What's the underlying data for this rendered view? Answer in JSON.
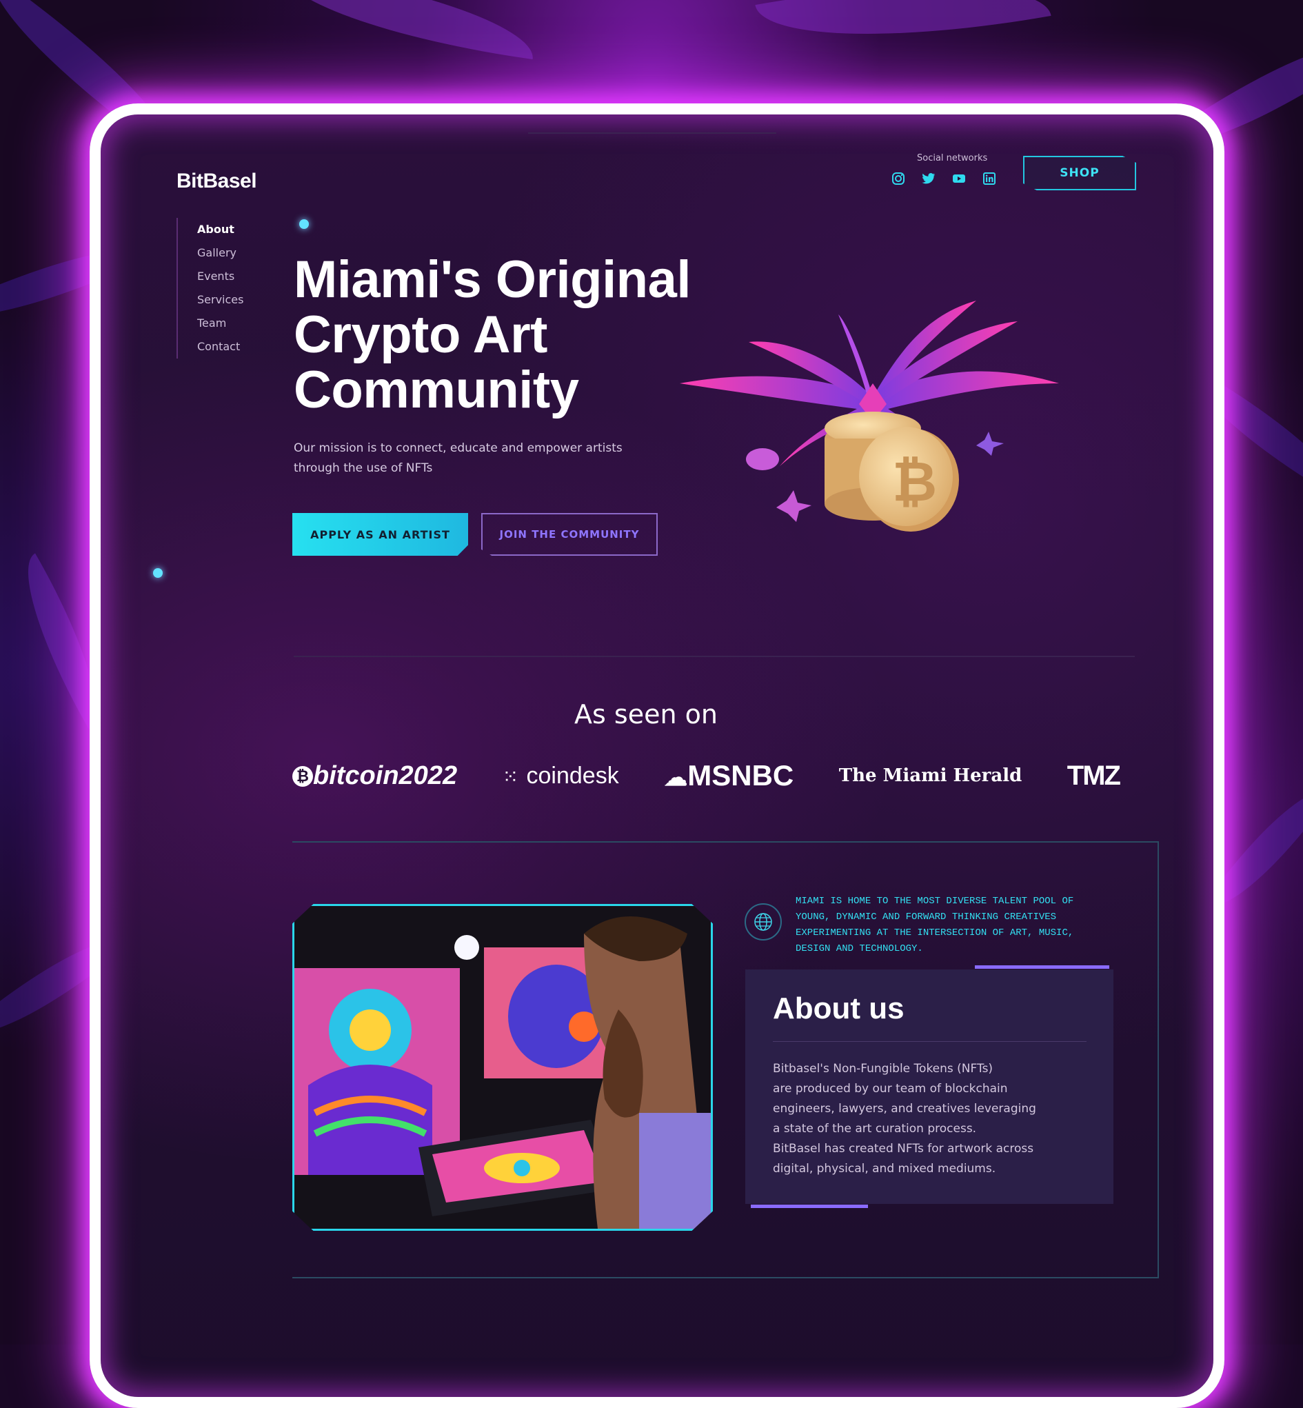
{
  "brand": {
    "logo_text": "BitBasel"
  },
  "nav": {
    "items": [
      {
        "label": "About",
        "active": true
      },
      {
        "label": "Gallery",
        "active": false
      },
      {
        "label": "Events",
        "active": false
      },
      {
        "label": "Services",
        "active": false
      },
      {
        "label": "Team",
        "active": false
      },
      {
        "label": "Contact",
        "active": false
      }
    ]
  },
  "header": {
    "social_label": "Social networks",
    "social_icons": [
      "instagram-icon",
      "twitter-icon",
      "youtube-icon",
      "linkedin-icon"
    ],
    "shop_label": "SHOP"
  },
  "hero": {
    "title_line1": "Miami's Original",
    "title_line2": "Crypto Art",
    "title_line3": "Community",
    "description": "Our mission is to connect, educate and empower artists through the use of NFTs",
    "apply_button": "APPLY AS AN ARTIST",
    "join_button": "JOIN THE COMMUNITY"
  },
  "press": {
    "title": "As seen on",
    "logos": [
      "bitcoin2022",
      "coindesk",
      "MSNBC",
      "The Miami Herald",
      "TMZ"
    ]
  },
  "about": {
    "mission": "MIAMI IS HOME TO THE MOST DIVERSE TALENT POOL OF YOUNG, DYNAMIC AND FORWARD THINKING CREATIVES EXPERIMENTING AT THE INTERSECTION OF ART, MUSIC, DESIGN AND TECHNOLOGY.",
    "title": "About us",
    "text_line1": "Bitbasel's Non-Fungible Tokens (NFTs)",
    "text_line2": "are produced by our team of blockchain",
    "text_line3": "engineers, lawyers, and creatives leveraging",
    "text_line4": "a state of the art curation process.",
    "text_line5": "BitBasel has created NFTs for artwork across",
    "text_line6": "digital, physical, and mixed mediums."
  },
  "colors": {
    "accent_cyan": "#27e0f0",
    "accent_purple": "#8a6bff",
    "frame_glow": "#e23bff",
    "background": "#241034"
  }
}
